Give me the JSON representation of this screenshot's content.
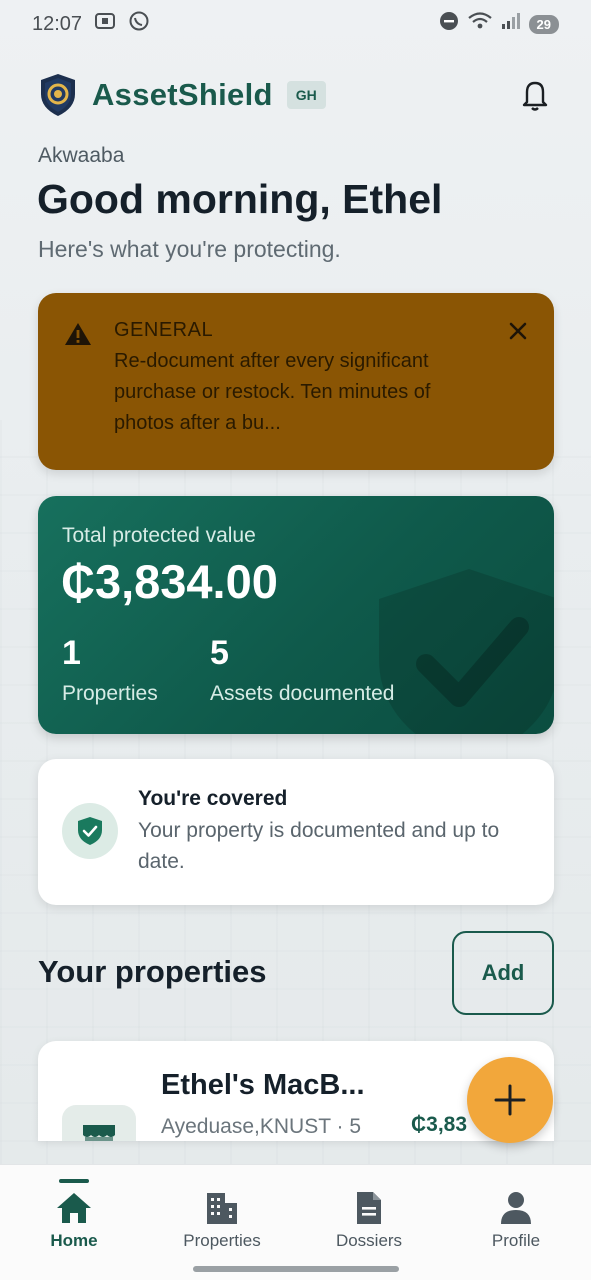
{
  "status_bar": {
    "time": "12:07",
    "battery": "29",
    "left_icons": [
      "screenshot-icon",
      "whatsapp-icon"
    ],
    "right_icons": [
      "do-not-disturb-icon",
      "wifi-icon",
      "signal-icon",
      "battery-icon"
    ]
  },
  "header": {
    "app_name": "AssetShield",
    "region": "GH",
    "logo_icon": "shield-logo-icon",
    "notification_icon": "bell-icon"
  },
  "greeting": {
    "sub": "Akwaaba",
    "title": "Good morning, Ethel",
    "description": "Here's what you're protecting."
  },
  "alert": {
    "title": "GENERAL",
    "text": "Re-document after every significant purchase or restock. Ten minutes of photos after a bu...",
    "icon": "warning-icon",
    "close_icon": "close-icon",
    "color": "#8a5504"
  },
  "summary": {
    "label": "Total protected value",
    "amount": "₵3,834.00",
    "properties_count": "1",
    "properties_label": "Properties",
    "assets_count": "5",
    "assets_label": "Assets documented",
    "color": "#0f5a4b"
  },
  "coverage": {
    "title": "You're covered",
    "description": "Your property is documented and up to date.",
    "icon": "shield-check-icon"
  },
  "properties_section": {
    "title": "Your properties",
    "add_label": "Add"
  },
  "property": {
    "name": "Ethel's MacB...",
    "meta": "Ayeduase,KNUST · 5",
    "value": "₵3,83",
    "icon": "storefront-icon"
  },
  "fab": {
    "icon": "plus-icon",
    "color": "#f2a73b"
  },
  "nav": {
    "items": [
      {
        "label": "Home",
        "icon": "home-icon",
        "active": true
      },
      {
        "label": "Properties",
        "icon": "building-icon",
        "active": false
      },
      {
        "label": "Dossiers",
        "icon": "document-icon",
        "active": false
      },
      {
        "label": "Profile",
        "icon": "person-icon",
        "active": false
      }
    ]
  },
  "colors": {
    "brand": "#1a5a4c",
    "accent": "#f2a73b"
  }
}
